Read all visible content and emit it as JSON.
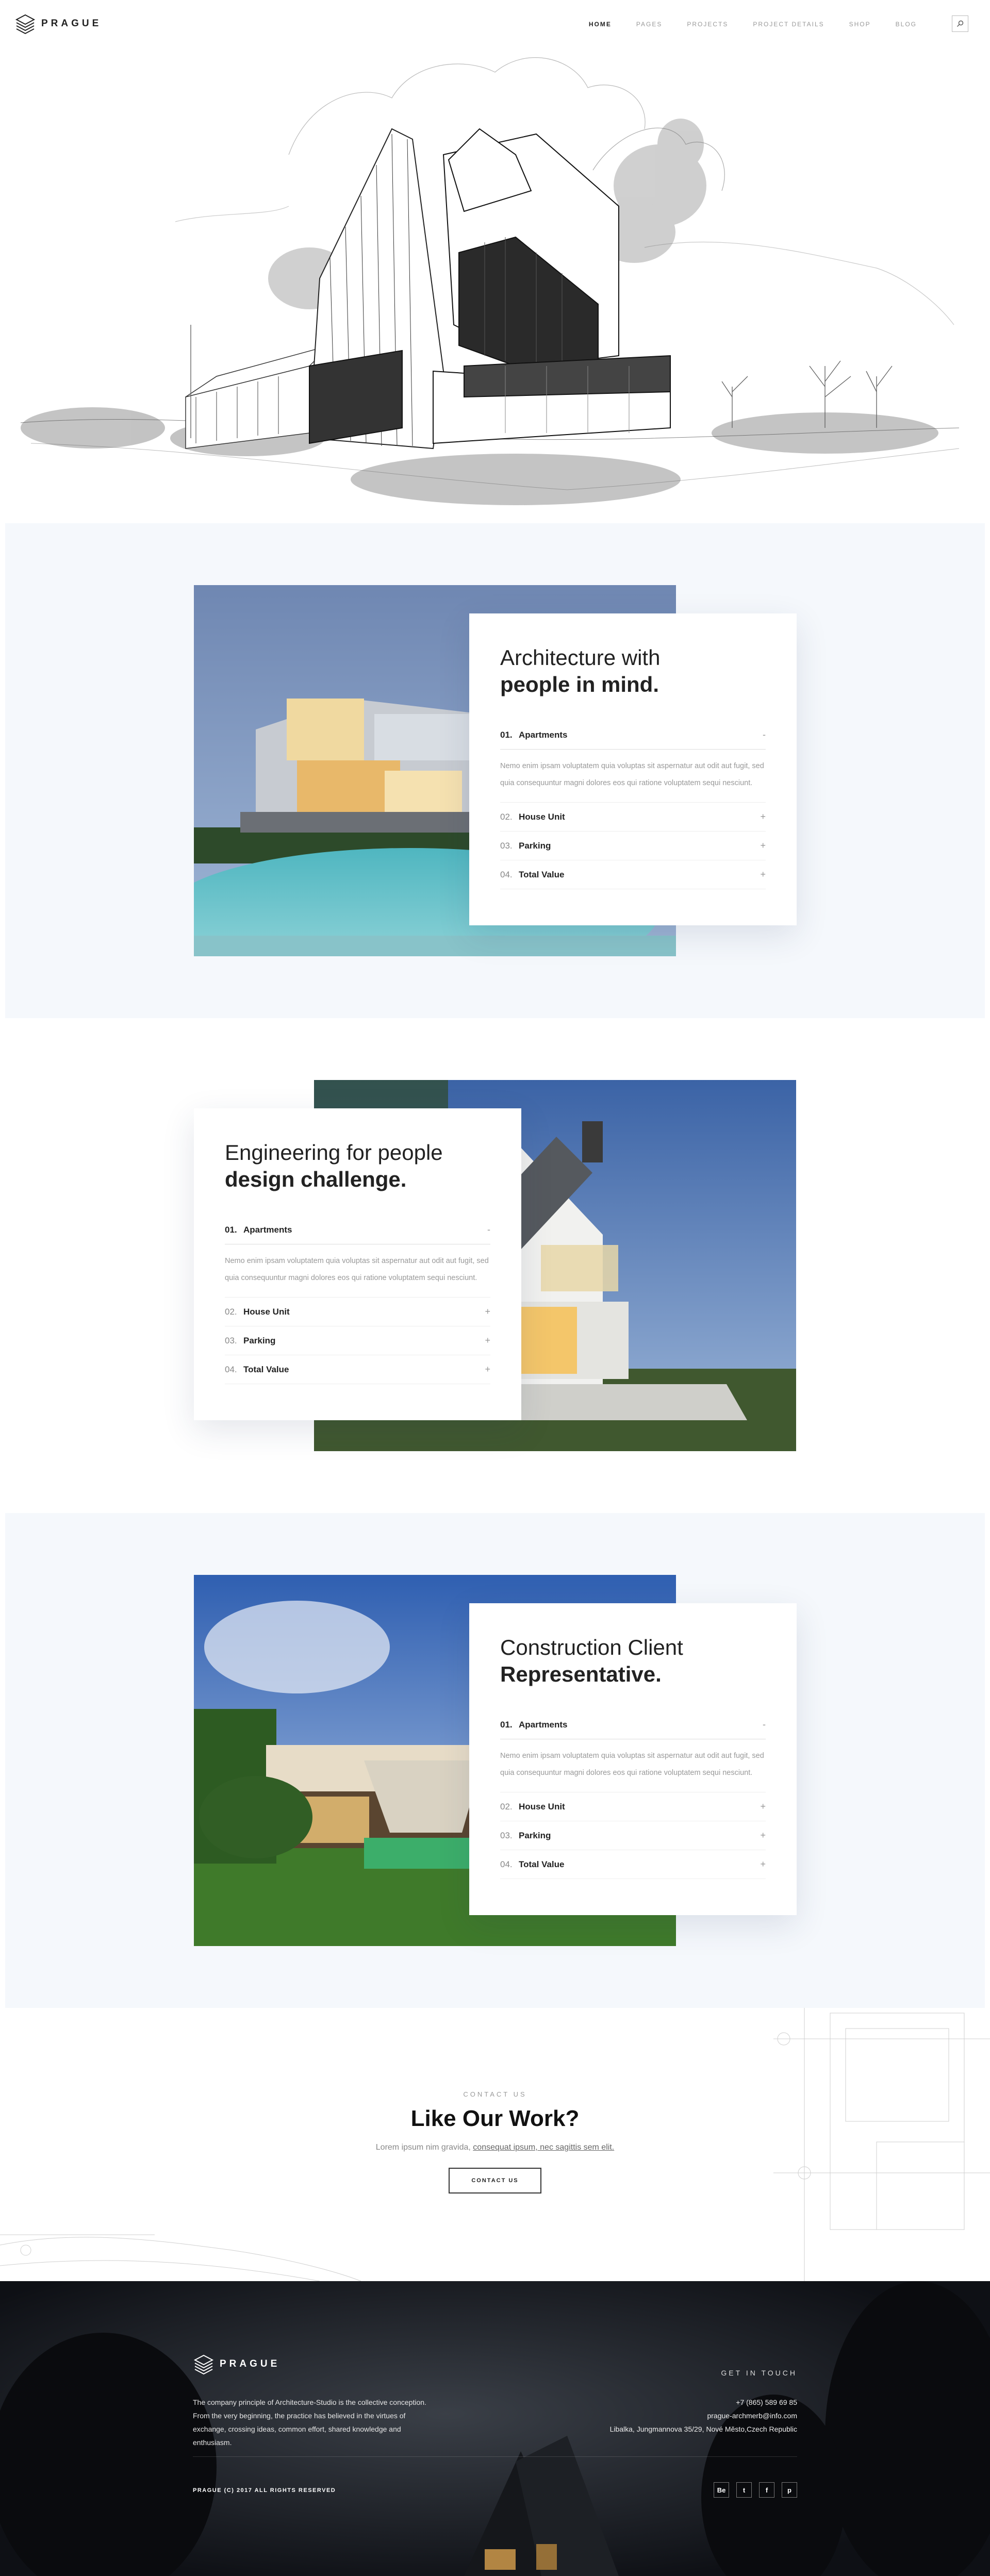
{
  "brand": {
    "name": "PRAGUE"
  },
  "nav": {
    "items": [
      {
        "label": "HOME",
        "active": true
      },
      {
        "label": "PAGES"
      },
      {
        "label": "PROJECTS"
      },
      {
        "label": "PROJECT DETAILS"
      },
      {
        "label": "SHOP"
      },
      {
        "label": "BLOG"
      }
    ],
    "search_icon": "search-icon"
  },
  "sections": [
    {
      "title_light": "Architecture with",
      "title_bold": "people in mind.",
      "accordion": [
        {
          "num": "01.",
          "title": "Apartments",
          "sign": "-",
          "open": true,
          "body": "Nemo enim ipsam voluptatem quia voluptas sit aspernatur aut odit aut fugit, sed quia consequuntur magni dolores eos qui ratione voluptatem sequi nesciunt."
        },
        {
          "num": "02.",
          "title": "House Unit",
          "sign": "+"
        },
        {
          "num": "03.",
          "title": "Parking",
          "sign": "+"
        },
        {
          "num": "04.",
          "title": "Total Value",
          "sign": "+"
        }
      ]
    },
    {
      "title_light": "Engineering for people",
      "title_bold": "design challenge.",
      "accordion": [
        {
          "num": "01.",
          "title": "Apartments",
          "sign": "-",
          "open": true,
          "body": "Nemo enim ipsam voluptatem quia voluptas sit aspernatur aut odit aut fugit, sed quia consequuntur magni dolores eos qui ratione voluptatem sequi nesciunt."
        },
        {
          "num": "02.",
          "title": "House Unit",
          "sign": "+"
        },
        {
          "num": "03.",
          "title": "Parking",
          "sign": "+"
        },
        {
          "num": "04.",
          "title": "Total Value",
          "sign": "+"
        }
      ]
    },
    {
      "title_light": "Construction Client",
      "title_bold": "Representative.",
      "accordion": [
        {
          "num": "01.",
          "title": "Apartments",
          "sign": "-",
          "open": true,
          "body": "Nemo enim ipsam voluptatem quia voluptas sit aspernatur aut odit aut fugit, sed quia consequuntur magni dolores eos qui ratione voluptatem sequi nesciunt."
        },
        {
          "num": "02.",
          "title": "House Unit",
          "sign": "+"
        },
        {
          "num": "03.",
          "title": "Parking",
          "sign": "+"
        },
        {
          "num": "04.",
          "title": "Total Value",
          "sign": "+"
        }
      ]
    }
  ],
  "contact": {
    "eyebrow": "CONTACT US",
    "title": "Like Our Work?",
    "text_plain": "Lorem ipsum nim gravida, ",
    "text_link": "consequat ipsum, nec sagittis sem elit.",
    "button": "CONTACT US"
  },
  "footer": {
    "description": "The company principle of Architecture-Studio is the collective conception. From the very beginning, the practice has believed in the virtues of exchange, crossing ideas, common effort, shared knowledge and enthusiasm.",
    "get_in_touch": "GET IN TOUCH",
    "phone": "+7 (865) 589 69 85",
    "email": "prague-archmerb@info.com",
    "address": "Libalka, Jungmannova 35/29, Nové Město,Czech Republic",
    "copyright": "PRAGUE (C) 2017 ALL RIGHTS RESERVED",
    "socials": [
      {
        "label": "Be",
        "icon": "behance-icon"
      },
      {
        "label": "t",
        "icon": "twitter-icon"
      },
      {
        "label": "f",
        "icon": "facebook-icon"
      },
      {
        "label": "p",
        "icon": "pinterest-icon"
      }
    ]
  },
  "colors": {
    "accent": "#222222",
    "section_bg": "#f5f8fc",
    "footer_bg": "#0e1015"
  }
}
